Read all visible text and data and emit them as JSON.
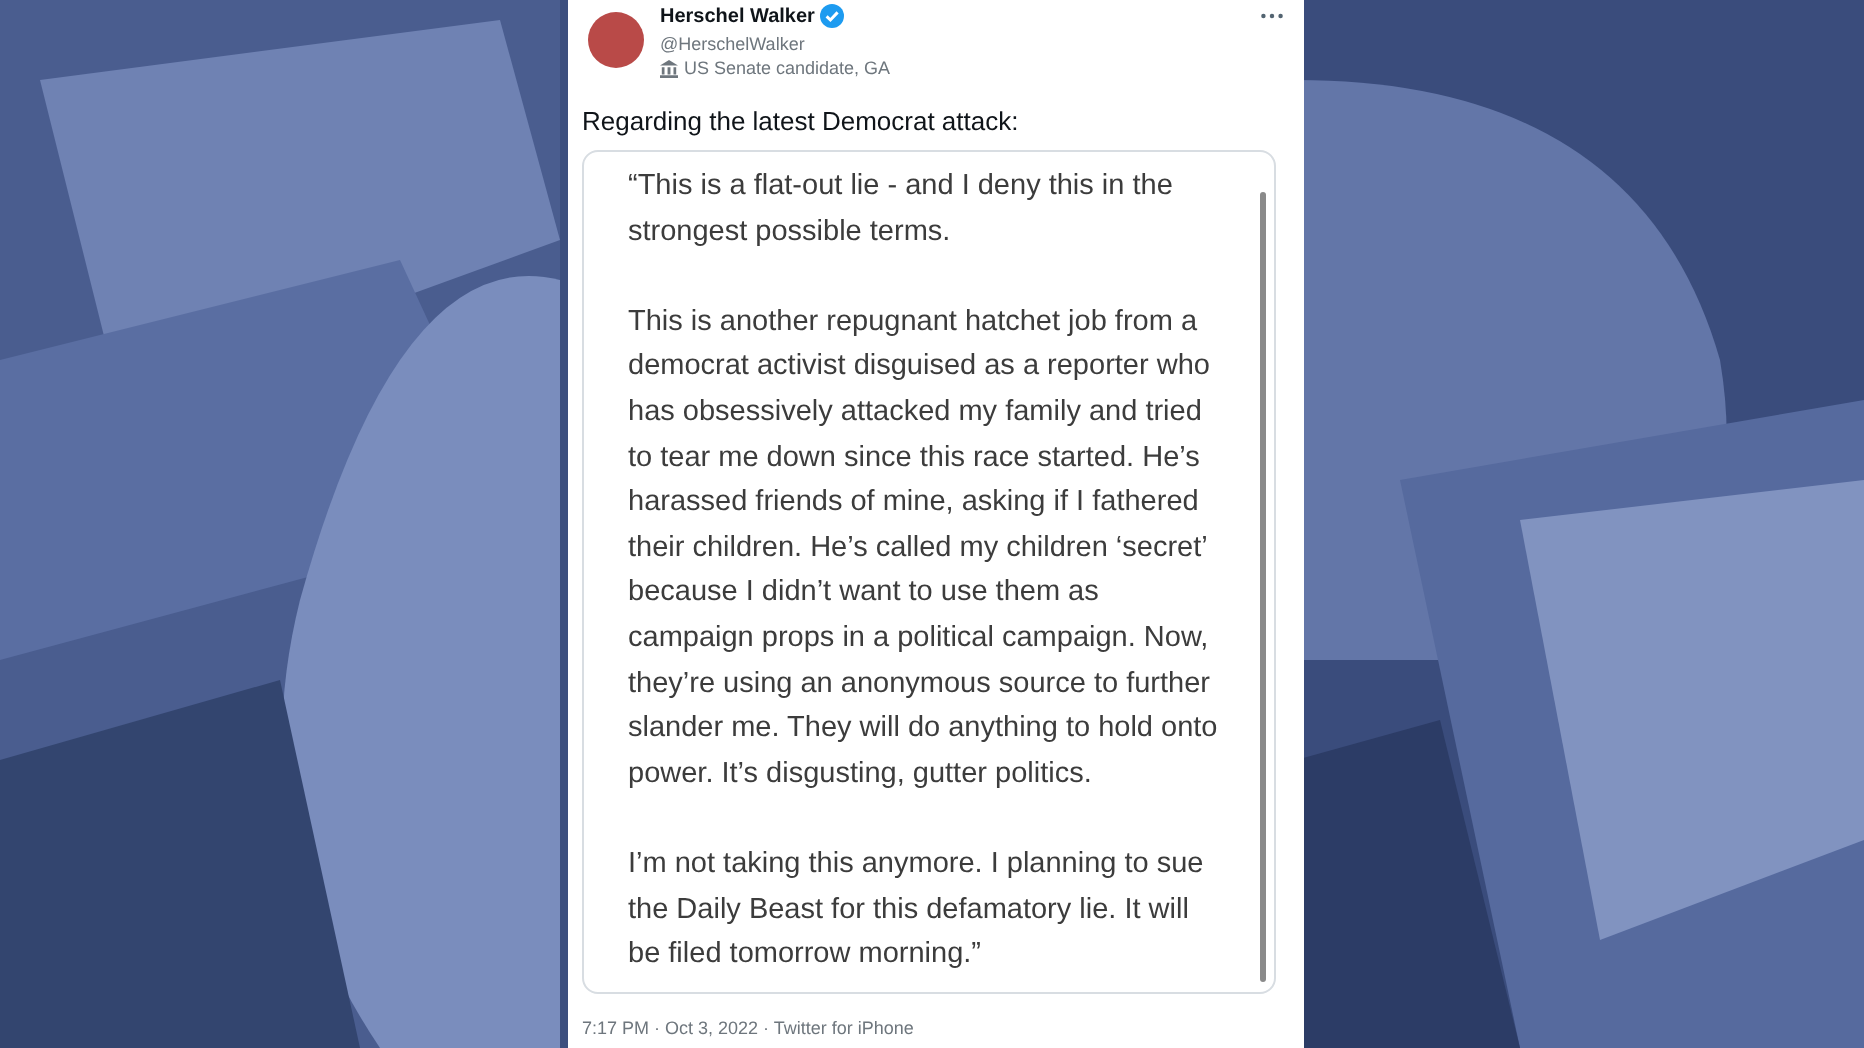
{
  "tweet": {
    "author": {
      "name": "Herschel Walker",
      "verified": true,
      "handle": "@HerschelWalker",
      "label": "US Senate candidate, GA"
    },
    "text": "Regarding the latest Democrat attack:",
    "statement": [
      "“This is a flat-out lie - and I deny this in the strongest possible terms.",
      "This is another repugnant hatchet job from a democrat activist disguised as a reporter who has obsessively attacked my family and tried to tear me down since this race started. He’s harassed friends of mine, asking if I fathered their children. He’s called my children ‘secret’ because I didn’t want to use them as campaign props in a political campaign. Now, they’re using an anonymous source to further slander me. They will do anything to hold onto power. It’s disgusting, gutter politics.",
      "I’m not taking this anymore. I planning to sue the Daily Beast for this defamatory lie. It will be filed tomorrow morning.”"
    ],
    "meta": "7:17 PM · Oct 3, 2022 · Twitter for iPhone"
  }
}
